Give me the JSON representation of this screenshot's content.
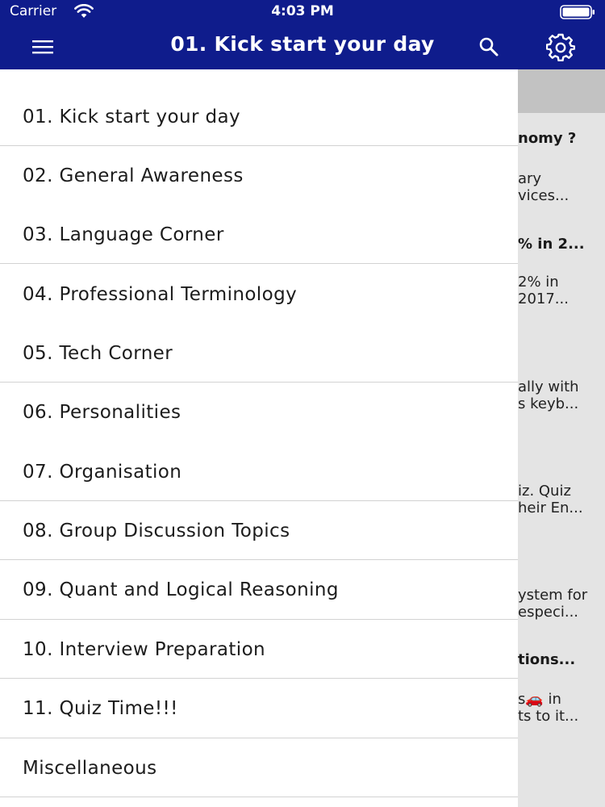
{
  "status_bar": {
    "carrier": "Carrier",
    "time": "4:03 PM"
  },
  "nav": {
    "title": "01. Kick start your day",
    "icons": [
      "menu-icon",
      "search-icon",
      "gear-icon"
    ]
  },
  "drawer": {
    "items": [
      "01. Kick start your day",
      "02. General Awareness",
      "03. Language Corner",
      "04. Professional Terminology",
      "05. Tech Corner",
      "06. Personalities",
      "07. Organisation",
      "08. Group Discussion Topics",
      "09. Quant and Logical Reasoning",
      "10. Interview Preparation",
      "11. Quiz Time!!!",
      "Miscellaneous"
    ]
  },
  "background_snippets": [
    "nomy ?",
    "ary",
    "vices...",
    "% in 2...",
    "2% in",
    "2017...",
    "ally with",
    "s keyb...",
    "iz.  Quiz",
    "heir En...",
    "ystem for",
    "especi...",
    "tions...",
    "s🚗 in",
    "ts to it..."
  ],
  "colors": {
    "nav_background": "#0f1c8c",
    "drawer_background": "#ffffff",
    "divider": "#d2d2d2"
  }
}
